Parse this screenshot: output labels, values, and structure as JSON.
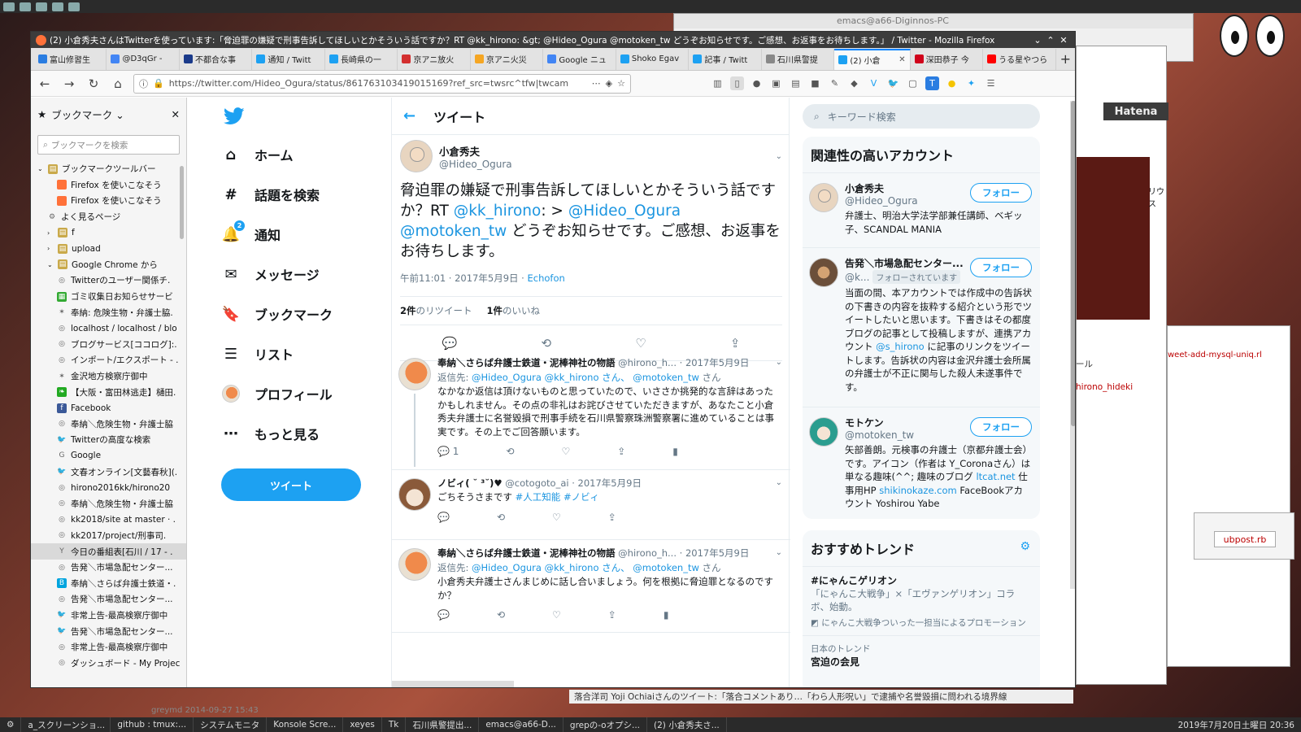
{
  "window": {
    "title": "(2) 小倉秀夫さんはTwitterを使っています:「脅迫罪の嫌疑で刑事告訴してほしいとかそういう話ですか？RT @kk_hirono: &gt; @Hideo_Ogura @motoken_tw どうぞお知らせです。ご感想、お返事をお待ちします。」 / Twitter - Mozilla Firefox"
  },
  "tabs": [
    {
      "label": "富山修習生",
      "color": "#2a7de1"
    },
    {
      "label": "@D3qGr -",
      "color": "#4285f4"
    },
    {
      "label": "不都合な事",
      "color": "#1a3a8a"
    },
    {
      "label": "通知 / Twitt",
      "color": "#1da1f2"
    },
    {
      "label": "長崎県の一",
      "color": "#1da1f2"
    },
    {
      "label": "京アニ放火",
      "color": "#d32f2f"
    },
    {
      "label": "京アニ火災",
      "color": "#f5a623"
    },
    {
      "label": "Google ニュ",
      "color": "#4285f4"
    },
    {
      "label": "Shoko Egav",
      "color": "#1da1f2"
    },
    {
      "label": "記事 / Twitt",
      "color": "#1da1f2"
    },
    {
      "label": "石川県警提",
      "color": "#888888"
    },
    {
      "label": "(2) 小倉",
      "color": "#1da1f2",
      "active": true
    },
    {
      "label": "深田恭子 今",
      "color": "#d0021b"
    },
    {
      "label": "うる星やつら",
      "color": "#ff0000"
    }
  ],
  "url": "https://twitter.com/Hideo_Ogura/status/861763103419015169?ref_src=twsrc^tfw|twcam",
  "sidebar": {
    "title": "ブックマーク",
    "search_placeholder": "ブックマークを検索",
    "items": [
      {
        "label": "ブックマークツールバー",
        "indent": 0,
        "icon": "folder"
      },
      {
        "label": "Firefox を使いこなそう",
        "indent": 2,
        "icon": "firefox"
      },
      {
        "label": "Firefox を使いこなそう",
        "indent": 2,
        "icon": "firefox"
      },
      {
        "label": "よく見るページ",
        "indent": 1,
        "icon": "gear"
      },
      {
        "label": "f",
        "indent": 1,
        "icon": "folder"
      },
      {
        "label": "upload",
        "indent": 1,
        "icon": "folder"
      },
      {
        "label": "Google Chrome から",
        "indent": 1,
        "icon": "folder"
      },
      {
        "label": "Twitterのユーザー関係チ.",
        "indent": 2,
        "icon": "globe"
      },
      {
        "label": "ゴミ収集日お知らせサービ",
        "indent": 2,
        "icon": "green"
      },
      {
        "label": "奉納: 危険生物・弁護士脇.",
        "indent": 2,
        "icon": "star"
      },
      {
        "label": "localhost / localhost / blo",
        "indent": 2,
        "icon": "globe"
      },
      {
        "label": "ブログサービス[ココログ]:.",
        "indent": 2,
        "icon": "globe"
      },
      {
        "label": "インポート/エクスポート - .",
        "indent": 2,
        "icon": "globe"
      },
      {
        "label": "金沢地方検察庁御中",
        "indent": 2,
        "icon": "star"
      },
      {
        "label": "【大阪・富田林逃走】樋田.",
        "indent": 2,
        "icon": "leaf"
      },
      {
        "label": "Facebook",
        "indent": 2,
        "icon": "facebook"
      },
      {
        "label": "奉納＼危険生物・弁護士脇",
        "indent": 2,
        "icon": "globe"
      },
      {
        "label": "Twitterの高度な検索",
        "indent": 2,
        "icon": "twitter"
      },
      {
        "label": "Google",
        "indent": 2,
        "icon": "google"
      },
      {
        "label": "文春オンライン[文藝春秋](.",
        "indent": 2,
        "icon": "twitter"
      },
      {
        "label": "hirono2016kk/hirono20",
        "indent": 2,
        "icon": "globe"
      },
      {
        "label": "奉納＼危険生物・弁護士脇",
        "indent": 2,
        "icon": "globe"
      },
      {
        "label": "kk2018/site at master · .",
        "indent": 2,
        "icon": "globe"
      },
      {
        "label": "kk2017/project/刑事司.",
        "indent": 2,
        "icon": "globe"
      },
      {
        "label": "今日の番組表[石川 / 17 - .",
        "indent": 2,
        "icon": "yahoo",
        "selected": true
      },
      {
        "label": "告発＼市場急配センター...",
        "indent": 2,
        "icon": "globe"
      },
      {
        "label": "奉納＼さらば弁護士鉄道・.",
        "indent": 2,
        "icon": "hatena"
      },
      {
        "label": "告発＼市場急配センター...",
        "indent": 2,
        "icon": "globe"
      },
      {
        "label": "非常上告-最高検察庁御中",
        "indent": 2,
        "icon": "twitter"
      },
      {
        "label": "告発＼市場急配センター...",
        "indent": 2,
        "icon": "twitter"
      },
      {
        "label": "非常上告-最高検察庁御中",
        "indent": 2,
        "icon": "globe"
      },
      {
        "label": "ダッシュボード - My Projec",
        "indent": 2,
        "icon": "globe"
      }
    ]
  },
  "nav": {
    "items": [
      {
        "label": "ホーム",
        "icon": "home-icon",
        "glyph": "⌂"
      },
      {
        "label": "話題を検索",
        "icon": "hashtag-icon",
        "glyph": "#"
      },
      {
        "label": "通知",
        "icon": "bell-icon",
        "glyph": "🔔",
        "badge": "2"
      },
      {
        "label": "メッセージ",
        "icon": "envelope-icon",
        "glyph": "✉"
      },
      {
        "label": "ブックマーク",
        "icon": "bookmark-icon",
        "glyph": "🔖"
      },
      {
        "label": "リスト",
        "icon": "list-icon",
        "glyph": "☰"
      },
      {
        "label": "プロフィール",
        "icon": "avatar-icon",
        "glyph": ""
      },
      {
        "label": "もっと見る",
        "icon": "more-icon",
        "glyph": "⋯"
      }
    ],
    "tweet_button": "ツイート"
  },
  "main": {
    "header": "ツイート",
    "focal": {
      "name": "小倉秀夫",
      "handle": "@Hideo_Ogura",
      "text_1": "脅迫罪の嫌疑で刑事告訴してほしいとかそういう話ですか？RT ",
      "mention_1": "@kk_hirono",
      "text_2": ": > ",
      "mention_2": "@Hideo_Ogura",
      "text_3": " ",
      "mention_3": "@motoken_tw",
      "text_4": " どうぞお知らせです。ご感想、お返事をお待ちします。",
      "time": "午前11:01 · 2017年5月9日 · ",
      "client": "Echofon",
      "retweets_count": "2件",
      "retweets_label": "のリツイート",
      "likes_count": "1件",
      "likes_label": "のいいね"
    },
    "replies": [
      {
        "name": "奉納＼さらば弁護士鉄道・泥棒神社の物語",
        "handle": "@hirono_h...",
        "date": "· 2017年5月9日",
        "reply_prefix": "返信先: ",
        "reply_to": "@Hideo_Ogura @kk_hirono さん、 @motoken_tw",
        "reply_suffix": "さん",
        "text": "なかなか返信は頂けないものと思っていたので、いささか挑発的な言辞はあったかもしれません。その点の非礼はお詫びさせていただきますが、あなたこと小倉秀夫弁護士に名誉毀損で刑事手続を石川県警察珠洲警察署に進めていることは事実です。その上でご回答願います。",
        "reply_count": "1"
      },
      {
        "name": "ノビィ( ˘ ³˘)♥",
        "handle": "@cotogoto_ai",
        "date": "· 2017年5月9日",
        "text_plain": "ごちそうさまです ",
        "tags": "#人工知能 #ノビィ"
      },
      {
        "name": "奉納＼さらば弁護士鉄道・泥棒神社の物語",
        "handle": "@hirono_h...",
        "date": "· 2017年5月9日",
        "reply_prefix": "返信先: ",
        "reply_to": "@Hideo_Ogura @kk_hirono さん、 @motoken_tw",
        "reply_suffix": "さん",
        "text": "小倉秀夫弁護士さんまじめに話し合いましょう。何を根拠に脅迫罪となるのですか？"
      }
    ]
  },
  "right": {
    "search_placeholder": "キーワード検索",
    "related_title": "関連性の高いアカウント",
    "follow_label": "フォロー",
    "accounts": [
      {
        "name": "小倉秀夫",
        "handle": "@Hideo_Ogura",
        "bio": "弁護士、明治大学法学部兼任講師、ベギッ子、SCANDAL MANIA"
      },
      {
        "name": "告発＼市場急配センター...",
        "handle": "@k...",
        "followed_badge": "フォローされています",
        "bio_1": "当面の間、本アカウントでは作成中の告訴状の下書きの内容を抜粋する紹介という形でツイートしたいと思います。下書きはその都度ブログの記事として投稿しますが、連携アカウント ",
        "bio_link": "@s_hirono",
        "bio_2": " に記事のリンクをツイートします。告訴状の内容は金沢弁護士会所属の弁護士が不正に関与した殺人未遂事件です。"
      },
      {
        "name": "モトケン",
        "handle": "@motoken_tw",
        "bio_1": "矢部善朗。元検事の弁護士（京都弁護士会）です。アイコン（作者は Y_Coronaさん）は単なる趣味(^^; 趣味のブログ ",
        "link_1": "ltcat.net",
        "bio_2": " 仕事用HP ",
        "link_2": "shikinokaze.com",
        "bio_3": " FaceBookアカウント Yoshirou Yabe"
      }
    ],
    "trends_title": "おすすめトレンド",
    "trend_1_name": "#にゃんこゲリオン",
    "trend_1_desc": "「にゃんこ大戦争」×「エヴァンゲリオン」コラボ、始動。",
    "trend_1_promo": "にゃんこ大戦争ついった一担当によるプロモーション",
    "trend_2_context": "日本のトレンド",
    "trend_2_name": "宮迫の会見"
  },
  "background": {
    "emacs_title": "emacs@a66-Diginnos-PC",
    "hatena": "Hatena",
    "ubpost": "ubpost.rb",
    "bg_text_1": "リウス",
    "bg_text_2": "ール",
    "bg_text_3": "hirono_hideki",
    "bg_text_4": "weet-add-mysql-uniq.rl",
    "bg_text_5": "落合洋司 Yoji Ochiaiさんのツイート:「落合コメントあり…「わら人形呪い」で逮捕や名誉毀損に問われる境界線",
    "bg_text_6": "greymd 2014-09-27 15:43"
  },
  "taskbar": [
    "a_スクリーンショ...",
    "github : tmux:...",
    "システムモニタ",
    "Konsole Scre...",
    "xeyes",
    "Tk",
    "石川県警提出...",
    "emacs@a66-D...",
    "grepの-oオプシ...",
    "(2) 小倉秀夫さ..."
  ],
  "clock": "2019年7月20日土曜日 20:36"
}
